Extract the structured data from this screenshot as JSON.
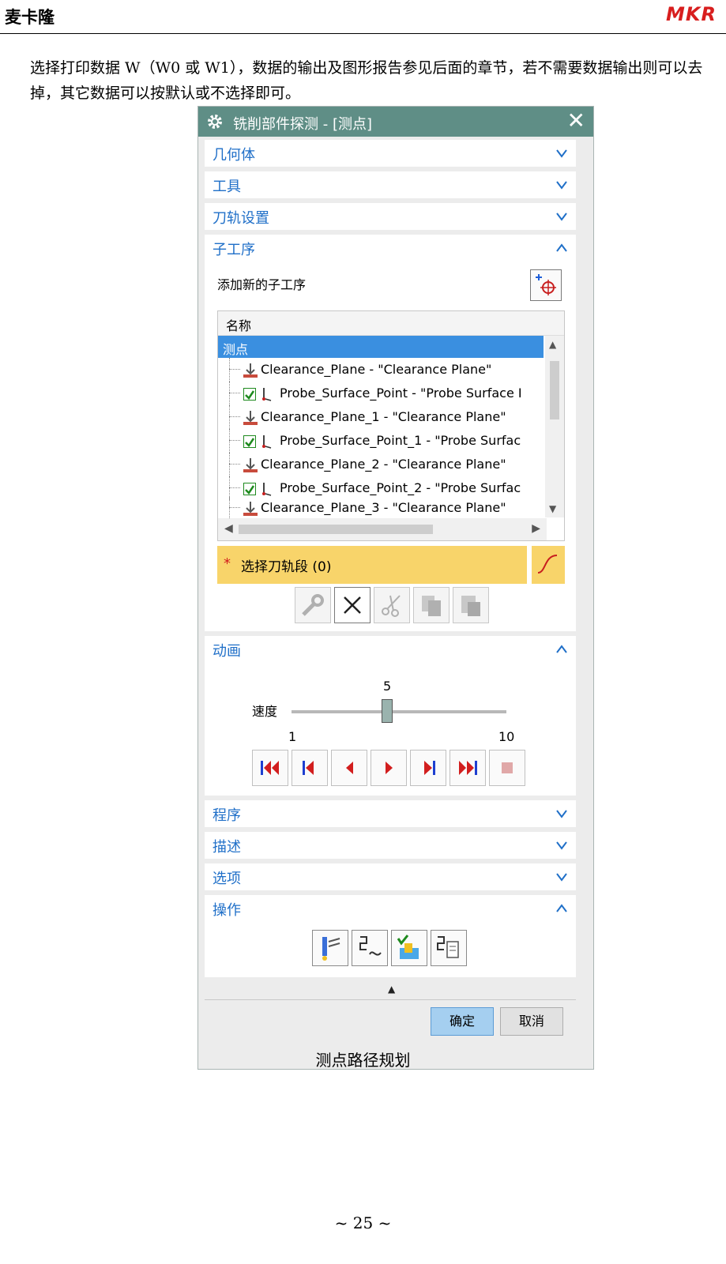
{
  "header": {
    "title": "麦卡隆",
    "logo": "MKR"
  },
  "intro_text": "选择打印数据 W（W0 或 W1），数据的输出及图形报告参见后面的章节，若不需要数据输出则可以去掉，其它数据可以按默认或不选择即可。",
  "dialog": {
    "title": "铣削部件探测 - [测点]",
    "sections": {
      "geometry": "几何体",
      "tool": "工具",
      "path_settings": "刀轨设置",
      "suboperations": "子工序",
      "animation": "动画",
      "program": "程序",
      "description": "描述",
      "options": "选项",
      "actions": "操作"
    },
    "add_sub_label": "添加新的子工序",
    "tree": {
      "column_header": "名称",
      "root": "测点",
      "rows": [
        "Clearance_Plane - \"Clearance Plane\"",
        "Probe_Surface_Point - \"Probe Surface I",
        "Clearance_Plane_1 - \"Clearance Plane\"",
        "Probe_Surface_Point_1 - \"Probe Surfac",
        "Clearance_Plane_2 - \"Clearance Plane\"",
        "Probe_Surface_Point_2 - \"Probe Surfac",
        "Clearance_Plane_3 - \"Clearance Plane\""
      ]
    },
    "select_segment": {
      "star": "*",
      "label": "选择刀轨段 (0)"
    },
    "speed": {
      "label": "速度",
      "value": "5",
      "min": "1",
      "max": "10"
    },
    "ok": "确定",
    "cancel": "取消"
  },
  "caption": "测点路径规划",
  "page_number": "~ 25 ~",
  "colors": {
    "titlebar": "#5f8e86",
    "section_label": "#1f6fc8",
    "selection": "#3a8fe0",
    "select_bar": "#f8d46a",
    "logo": "#d81e1e"
  },
  "icons": [
    "gear-icon",
    "close-icon",
    "chevron-down-icon",
    "chevron-up-icon",
    "add-suboperation-icon",
    "clearance-plane-icon",
    "probe-icon",
    "checkbox-icon",
    "curve-icon",
    "wrench-icon",
    "delete-icon",
    "cut-icon",
    "copy-icon",
    "paste-icon",
    "first-icon",
    "prev-step-icon",
    "reverse-icon",
    "play-icon",
    "next-step-icon",
    "last-icon",
    "stop-icon",
    "generate-icon",
    "replay-icon",
    "verify-icon",
    "list-icon"
  ]
}
